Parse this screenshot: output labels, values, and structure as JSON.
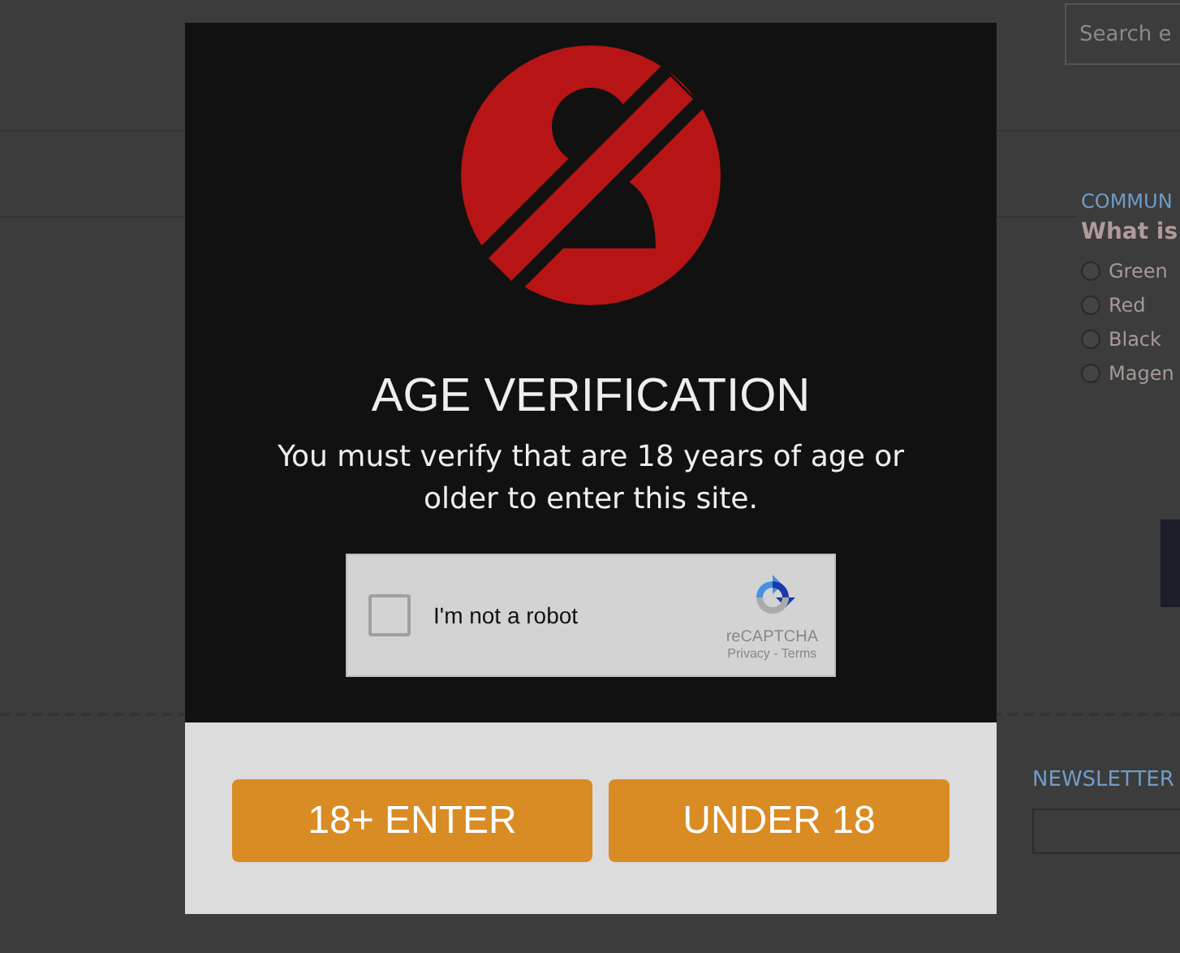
{
  "background": {
    "search": {
      "placeholder": "Search e"
    },
    "poll": {
      "title": "COMMUN",
      "question": "What is",
      "options": [
        {
          "label": "Green",
          "selected": false
        },
        {
          "label": "Red",
          "selected": false
        },
        {
          "label": "Black",
          "selected": false
        },
        {
          "label": "Magen",
          "selected": false
        }
      ]
    },
    "newsletter": {
      "title": "NEWSLETTER"
    }
  },
  "modal": {
    "title": "AGE VERIFICATION",
    "message": "You must verify that are 18 years of age or older to enter this site.",
    "captcha": {
      "label": "I'm not a robot",
      "checked": false,
      "brand": "reCAPTCHA",
      "links": "Privacy - Terms"
    },
    "buttons": [
      "18+ ENTER",
      "UNDER 18"
    ]
  }
}
